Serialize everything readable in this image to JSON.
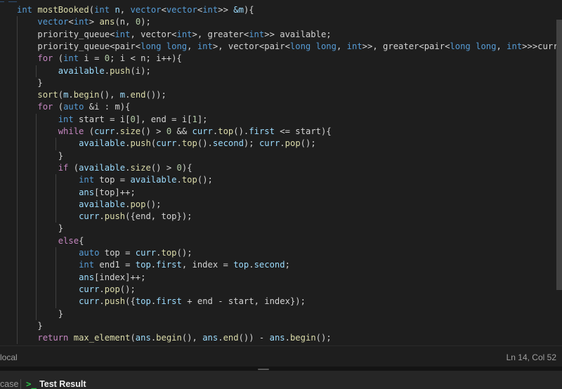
{
  "editor": {
    "lines": [
      [
        [
          "kw",
          "int"
        ],
        [
          "op",
          " "
        ],
        [
          "fn",
          "mostBooked"
        ],
        [
          "op",
          "("
        ],
        [
          "kw",
          "int"
        ],
        [
          "op",
          " "
        ],
        [
          "var",
          "n"
        ],
        [
          "op",
          ", "
        ],
        [
          "kw",
          "vector"
        ],
        [
          "op",
          "<"
        ],
        [
          "kw",
          "vector"
        ],
        [
          "op",
          "<"
        ],
        [
          "kw",
          "int"
        ],
        [
          "op",
          ">> "
        ],
        [
          "var",
          "&m"
        ],
        [
          "op",
          "){"
        ]
      ],
      [
        [
          "op",
          "    "
        ],
        [
          "kw",
          "vector"
        ],
        [
          "op",
          "<"
        ],
        [
          "kw",
          "int"
        ],
        [
          "op",
          "> "
        ],
        [
          "fn",
          "ans"
        ],
        [
          "op",
          "(n, "
        ],
        [
          "num",
          "0"
        ],
        [
          "op",
          ");"
        ]
      ],
      [
        [
          "op",
          "    priority_queue<"
        ],
        [
          "kw",
          "int"
        ],
        [
          "op",
          ", vector<"
        ],
        [
          "kw",
          "int"
        ],
        [
          "op",
          ">, greater<"
        ],
        [
          "kw",
          "int"
        ],
        [
          "op",
          ">> available;"
        ]
      ],
      [
        [
          "op",
          "    priority_queue<pair<"
        ],
        [
          "kw",
          "long long"
        ],
        [
          "op",
          ", "
        ],
        [
          "kw",
          "int"
        ],
        [
          "op",
          ">, vector<pair<"
        ],
        [
          "kw",
          "long long"
        ],
        [
          "op",
          ", "
        ],
        [
          "kw",
          "int"
        ],
        [
          "op",
          ">>, greater<pair<"
        ],
        [
          "kw",
          "long long"
        ],
        [
          "op",
          ", "
        ],
        [
          "kw",
          "int"
        ],
        [
          "op",
          ">>>curr;"
        ]
      ],
      [
        [
          "op",
          "    "
        ],
        [
          "ctl",
          "for"
        ],
        [
          "op",
          " ("
        ],
        [
          "kw",
          "int"
        ],
        [
          "op",
          " i = "
        ],
        [
          "num",
          "0"
        ],
        [
          "op",
          "; i < n; i++){"
        ]
      ],
      [
        [
          "op",
          "        "
        ],
        [
          "var",
          "available"
        ],
        [
          "op",
          "."
        ],
        [
          "fn",
          "push"
        ],
        [
          "op",
          "(i);"
        ]
      ],
      [
        [
          "op",
          "    }"
        ]
      ],
      [
        [
          "op",
          "    "
        ],
        [
          "fn",
          "sort"
        ],
        [
          "op",
          "("
        ],
        [
          "var",
          "m"
        ],
        [
          "op",
          "."
        ],
        [
          "fn",
          "begin"
        ],
        [
          "op",
          "(), "
        ],
        [
          "var",
          "m"
        ],
        [
          "op",
          "."
        ],
        [
          "fn",
          "end"
        ],
        [
          "op",
          "());"
        ]
      ],
      [
        [
          "op",
          "    "
        ],
        [
          "ctl",
          "for"
        ],
        [
          "op",
          " ("
        ],
        [
          "kw",
          "auto"
        ],
        [
          "op",
          " &i : m){"
        ]
      ],
      [
        [
          "op",
          "        "
        ],
        [
          "kw",
          "int"
        ],
        [
          "op",
          " start = i["
        ],
        [
          "num",
          "0"
        ],
        [
          "op",
          "], end = i["
        ],
        [
          "num",
          "1"
        ],
        [
          "op",
          "];"
        ]
      ],
      [
        [
          "op",
          "        "
        ],
        [
          "ctl",
          "while"
        ],
        [
          "op",
          " ("
        ],
        [
          "var",
          "curr"
        ],
        [
          "op",
          "."
        ],
        [
          "fn",
          "size"
        ],
        [
          "op",
          "() > "
        ],
        [
          "num",
          "0"
        ],
        [
          "op",
          " && "
        ],
        [
          "var",
          "curr"
        ],
        [
          "op",
          "."
        ],
        [
          "fn",
          "top"
        ],
        [
          "op",
          "()."
        ],
        [
          "var",
          "first"
        ],
        [
          "op",
          " <= start){"
        ]
      ],
      [
        [
          "op",
          "            "
        ],
        [
          "var",
          "available"
        ],
        [
          "op",
          "."
        ],
        [
          "fn",
          "push"
        ],
        [
          "op",
          "("
        ],
        [
          "var",
          "curr"
        ],
        [
          "op",
          "."
        ],
        [
          "fn",
          "top"
        ],
        [
          "op",
          "()."
        ],
        [
          "var",
          "second"
        ],
        [
          "op",
          "); "
        ],
        [
          "var",
          "curr"
        ],
        [
          "op",
          "."
        ],
        [
          "fn",
          "pop"
        ],
        [
          "op",
          "();"
        ]
      ],
      [
        [
          "op",
          "        }"
        ]
      ],
      [
        [
          "op",
          "        "
        ],
        [
          "ctl",
          "if"
        ],
        [
          "op",
          " ("
        ],
        [
          "var",
          "available"
        ],
        [
          "op",
          "."
        ],
        [
          "fn",
          "size"
        ],
        [
          "op",
          "() > "
        ],
        [
          "num",
          "0"
        ],
        [
          "op",
          "){"
        ]
      ],
      [
        [
          "op",
          "            "
        ],
        [
          "kw",
          "int"
        ],
        [
          "op",
          " top = "
        ],
        [
          "var",
          "available"
        ],
        [
          "op",
          "."
        ],
        [
          "fn",
          "top"
        ],
        [
          "op",
          "();"
        ]
      ],
      [
        [
          "op",
          "            "
        ],
        [
          "var",
          "ans"
        ],
        [
          "op",
          "[top]++;"
        ]
      ],
      [
        [
          "op",
          "            "
        ],
        [
          "var",
          "available"
        ],
        [
          "op",
          "."
        ],
        [
          "fn",
          "pop"
        ],
        [
          "op",
          "();"
        ]
      ],
      [
        [
          "op",
          "            "
        ],
        [
          "var",
          "curr"
        ],
        [
          "op",
          "."
        ],
        [
          "fn",
          "push"
        ],
        [
          "op",
          "({end, top});"
        ]
      ],
      [
        [
          "op",
          "        }"
        ]
      ],
      [
        [
          "op",
          "        "
        ],
        [
          "ctl",
          "else"
        ],
        [
          "op",
          "{"
        ]
      ],
      [
        [
          "op",
          "            "
        ],
        [
          "kw",
          "auto"
        ],
        [
          "op",
          " top = "
        ],
        [
          "var",
          "curr"
        ],
        [
          "op",
          "."
        ],
        [
          "fn",
          "top"
        ],
        [
          "op",
          "();"
        ]
      ],
      [
        [
          "op",
          "            "
        ],
        [
          "kw",
          "int"
        ],
        [
          "op",
          " end1 = "
        ],
        [
          "var",
          "top"
        ],
        [
          "op",
          "."
        ],
        [
          "var",
          "first"
        ],
        [
          "op",
          ", index = "
        ],
        [
          "var",
          "top"
        ],
        [
          "op",
          "."
        ],
        [
          "var",
          "second"
        ],
        [
          "op",
          ";"
        ]
      ],
      [
        [
          "op",
          "            "
        ],
        [
          "var",
          "ans"
        ],
        [
          "op",
          "[index]++;"
        ]
      ],
      [
        [
          "op",
          "            "
        ],
        [
          "var",
          "curr"
        ],
        [
          "op",
          "."
        ],
        [
          "fn",
          "pop"
        ],
        [
          "op",
          "();"
        ]
      ],
      [
        [
          "op",
          "            "
        ],
        [
          "var",
          "curr"
        ],
        [
          "op",
          "."
        ],
        [
          "fn",
          "push"
        ],
        [
          "op",
          "({"
        ],
        [
          "var",
          "top"
        ],
        [
          "op",
          "."
        ],
        [
          "var",
          "first"
        ],
        [
          "op",
          " + end - start, index});"
        ]
      ],
      [
        [
          "op",
          "        }"
        ]
      ],
      [
        [
          "op",
          "    }"
        ]
      ],
      [
        [
          "op",
          "    "
        ],
        [
          "ctl",
          "return"
        ],
        [
          "op",
          " "
        ],
        [
          "fn",
          "max_element"
        ],
        [
          "op",
          "("
        ],
        [
          "var",
          "ans"
        ],
        [
          "op",
          "."
        ],
        [
          "fn",
          "begin"
        ],
        [
          "op",
          "(), "
        ],
        [
          "var",
          "ans"
        ],
        [
          "op",
          "."
        ],
        [
          "fn",
          "end"
        ],
        [
          "op",
          "()) - "
        ],
        [
          "var",
          "ans"
        ],
        [
          "op",
          "."
        ],
        [
          "fn",
          "begin"
        ],
        [
          "op",
          "();"
        ]
      ]
    ]
  },
  "statusbar": {
    "left": "local",
    "cursor": "Ln 14, Col 52"
  },
  "bottom_panel": {
    "tab_case": "case",
    "tab_result": "Test Result",
    "result_icon": "terminal-prompt-icon"
  },
  "colors": {
    "keyword": "#569cd6",
    "control": "#c586c0",
    "function": "#dcdcaa",
    "variable": "#9cdcfe",
    "number": "#b5cea8",
    "text": "#d4d4d4",
    "accent_green": "#28c244"
  }
}
